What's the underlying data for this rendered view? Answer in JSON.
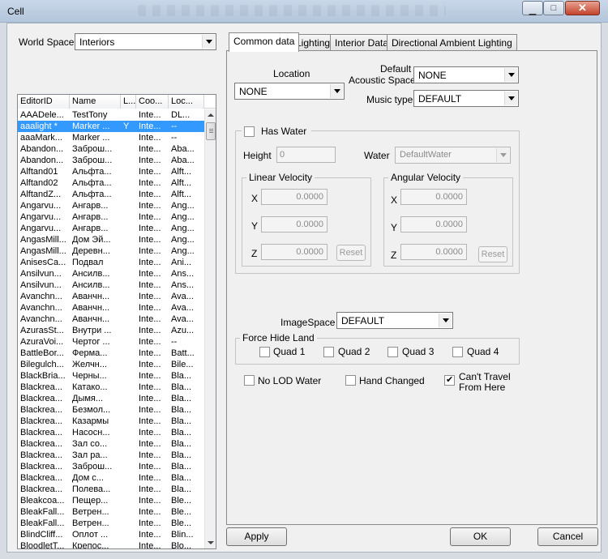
{
  "window": {
    "title": "Cell"
  },
  "world_space": {
    "label": "World Space",
    "value": "Interiors"
  },
  "list": {
    "columns": [
      "EditorID",
      "Name",
      "L...",
      "Coo...",
      "Loc..."
    ],
    "rows": [
      [
        "AAADele...",
        "TestTony",
        "",
        "Inte...",
        "DL..."
      ],
      [
        "aaalight *",
        "Marker ...",
        "Y",
        "Inte...",
        "--"
      ],
      [
        "aaaMark...",
        "Marker ...",
        "",
        "Inte...",
        "--"
      ],
      [
        "Abandon...",
        "Заброш...",
        "",
        "Inte...",
        "Aba..."
      ],
      [
        "Abandon...",
        "Заброш...",
        "",
        "Inte...",
        "Aba..."
      ],
      [
        "Alftand01",
        "Альфта...",
        "",
        "Inte...",
        "Alft..."
      ],
      [
        "Alftand02",
        "Альфта...",
        "",
        "Inte...",
        "Alft..."
      ],
      [
        "AlftandZ...",
        "Альфта...",
        "",
        "Inte...",
        "Alft..."
      ],
      [
        "Angarvu...",
        "Ангарв...",
        "",
        "Inte...",
        "Ang..."
      ],
      [
        "Angarvu...",
        "Ангарв...",
        "",
        "Inte...",
        "Ang..."
      ],
      [
        "Angarvu...",
        "Ангарв...",
        "",
        "Inte...",
        "Ang..."
      ],
      [
        "AngasMill...",
        "Дом Эй...",
        "",
        "Inte...",
        "Ang..."
      ],
      [
        "AngasMill...",
        "Деревн...",
        "",
        "Inte...",
        "Ang..."
      ],
      [
        "AnisesCa...",
        "Подвал",
        "",
        "Inte...",
        "Ani..."
      ],
      [
        "Ansilvun...",
        "Ансилв...",
        "",
        "Inte...",
        "Ans..."
      ],
      [
        "Ansilvun...",
        "Ансилв...",
        "",
        "Inte...",
        "Ans..."
      ],
      [
        "Avanchn...",
        "Аванчн...",
        "",
        "Inte...",
        "Ava..."
      ],
      [
        "Avanchn...",
        "Аванчн...",
        "",
        "Inte...",
        "Ava..."
      ],
      [
        "Avanchn...",
        "Аванчн...",
        "",
        "Inte...",
        "Ava..."
      ],
      [
        "AzurasSt...",
        "Внутри ...",
        "",
        "Inte...",
        "Azu..."
      ],
      [
        "AzuraVoi...",
        "Чертог ...",
        "",
        "Inte...",
        "--"
      ],
      [
        "BattleBor...",
        "Ферма...",
        "",
        "Inte...",
        "Batt..."
      ],
      [
        "Bilegulch...",
        "Желчн...",
        "",
        "Inte...",
        "Bile..."
      ],
      [
        "BlackBria...",
        "Черны...",
        "",
        "Inte...",
        "Bla..."
      ],
      [
        "Blackrea...",
        "Катако...",
        "",
        "Inte...",
        "Bla..."
      ],
      [
        "Blackrea...",
        "Дымя...",
        "",
        "Inte...",
        "Bla..."
      ],
      [
        "Blackrea...",
        "Безмол...",
        "",
        "Inte...",
        "Bla..."
      ],
      [
        "Blackrea...",
        "Казармы",
        "",
        "Inte...",
        "Bla..."
      ],
      [
        "Blackrea...",
        "Насосн...",
        "",
        "Inte...",
        "Bla..."
      ],
      [
        "Blackrea...",
        "Зал со...",
        "",
        "Inte...",
        "Bla..."
      ],
      [
        "Blackrea...",
        "Зал ра...",
        "",
        "Inte...",
        "Bla..."
      ],
      [
        "Blackrea...",
        "Заброш...",
        "",
        "Inte...",
        "Bla..."
      ],
      [
        "Blackrea...",
        "Дом с...",
        "",
        "Inte...",
        "Bla..."
      ],
      [
        "Blackrea...",
        "Полева...",
        "",
        "Inte...",
        "Bla..."
      ],
      [
        "Bleakcoa...",
        "Пещер...",
        "",
        "Inte...",
        "Ble..."
      ],
      [
        "BleakFall...",
        "Ветрен...",
        "",
        "Inte...",
        "Ble..."
      ],
      [
        "BleakFall...",
        "Ветрен...",
        "",
        "Inte...",
        "Ble..."
      ],
      [
        "BlindCliff...",
        "Оплот ...",
        "",
        "Inte...",
        "Blin..."
      ],
      [
        "BloodletT...",
        "Крепос...",
        "",
        "Inte...",
        "Blo..."
      ]
    ],
    "selected_index": 1
  },
  "tabs": [
    {
      "label": "Common data",
      "active": true
    },
    {
      "label": "Lighting"
    },
    {
      "label": "Interior Data"
    },
    {
      "label": "Directional Ambient Lighting"
    }
  ],
  "common": {
    "location_label": "Location",
    "location_value": "NONE",
    "acoustic_label_1": "Default",
    "acoustic_label_2": "Acoustic Space",
    "acoustic_value": "NONE",
    "music_label": "Music type",
    "music_value": "DEFAULT",
    "has_water": {
      "label": "Has Water",
      "checked": false
    },
    "height_label": "Height",
    "height_value": "0",
    "water_label": "Water",
    "water_value": "DefaultWater",
    "linear_velocity": {
      "title": "Linear Velocity",
      "x": "0.0000",
      "y": "0.0000",
      "z": "0.0000",
      "reset": "Reset"
    },
    "angular_velocity": {
      "title": "Angular Velocity",
      "x": "0.0000",
      "y": "0.0000",
      "z": "0.0000",
      "reset": "Reset"
    },
    "axis_x": "X",
    "axis_y": "Y",
    "axis_z": "Z",
    "imagespace_label": "ImageSpace",
    "imagespace_value": "DEFAULT",
    "force_hide_land": {
      "title": "Force Hide Land",
      "quads": [
        {
          "label": "Quad 1",
          "checked": false
        },
        {
          "label": "Quad 2",
          "checked": false
        },
        {
          "label": "Quad 3",
          "checked": false
        },
        {
          "label": "Quad 4",
          "checked": false
        }
      ]
    },
    "no_lod_water": {
      "label": "No LOD Water",
      "checked": false
    },
    "hand_changed": {
      "label": "Hand Changed",
      "checked": false
    },
    "cant_travel": {
      "label_1": "Can't Travel",
      "label_2": "From Here",
      "checked": true
    }
  },
  "buttons": {
    "apply": "Apply",
    "ok": "OK",
    "cancel": "Cancel"
  }
}
